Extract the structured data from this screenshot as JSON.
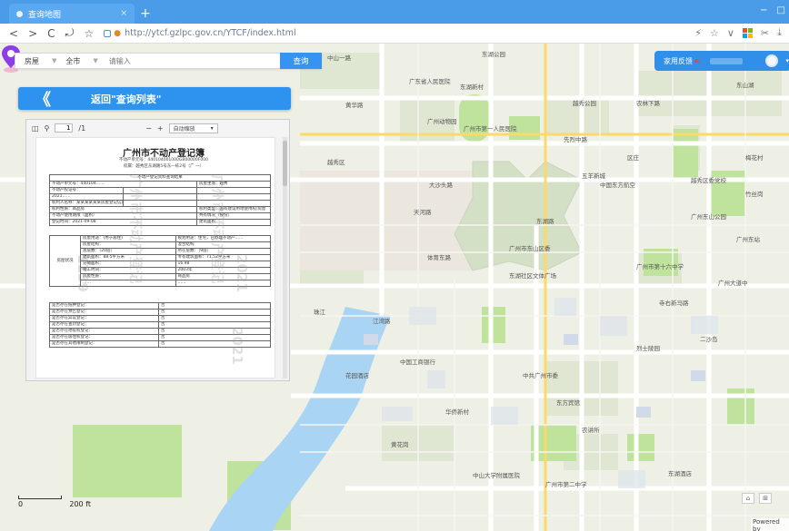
{
  "browser": {
    "tab_title": "查询地图",
    "tab_close": "×",
    "new_tab": "+",
    "win_min": "−",
    "win_max": "□",
    "nav": {
      "back": "<",
      "forward": ">",
      "reload": "C",
      "undo": "⤾",
      "star": "☆"
    },
    "url": "http://ytcf.gzlpc.gov.cn/YTCF/index.html",
    "right_icons": {
      "share": "⚡",
      "fav": "☆",
      "menu": "∨",
      "ms_apps": "ms",
      "cut": "✂",
      "download": "⤓"
    }
  },
  "search": {
    "type_select": "房屋",
    "district_select": "全市",
    "input_placeholder": "请输入",
    "caret": "▼",
    "button": "查询"
  },
  "back_button": {
    "chevron": "《",
    "label": "返回\"查询列表\""
  },
  "user_bar": {
    "label": "家用反馈",
    "dropdown": "▾"
  },
  "doc_viewer": {
    "page": "1",
    "total": "/1",
    "zoom_minus": "−",
    "zoom_plus": "+",
    "zoom_select": "自动缩放",
    "caret": "▾",
    "document": {
      "title": "广州市不动产登记簿",
      "sub1": "不动产单元号：440104001000GB00000F000",
      "sub2": "权属：越秀区东湖路5号东一栋2号（广 一）",
      "head": "不动产登记资料查询结果",
      "rows": [
        [
          "不动产单元号：440104……",
          "房屋坐落：越秀"
        ],
        [
          "不动产权证号：",
          "",
          ""
        ],
        [
          "2021……",
          "",
          ""
        ],
        [
          "权利人名称：某某某某某某房屋登记信息",
          "",
          ""
        ],
        [
          "权利性质：商品房",
          "权利类型：国有建设用地使用权/房屋"
        ],
        [
          "不动产使用期限（面积）",
          "共有情况（按份）"
        ],
        [
          "登记时间：2021-09-08",
          "建筑面积"
        ]
      ],
      "block_label": "房屋状况",
      "block_rows": [
        [
          "房屋用途：(用于居住)",
          "规划用途：住宅，已办理不动产……"
        ],
        [
          "房屋结构：",
          "混合结构"
        ],
        [
          "总层数：（20层）",
          "所在层数：（9层）"
        ],
        [
          "建筑面积：88.5平方米",
          "专有建筑面积：71.52平方米"
        ],
        [
          "分摊面积：",
          "16.98"
        ],
        [
          "竣工时间：",
          "2003年"
        ],
        [
          "房屋性质：",
          "商品房"
        ],
        [
          "……",
          "……"
        ]
      ],
      "q_rows": [
        [
          "是否存在抵押登记：",
          "否"
        ],
        [
          "是否存在预告登记：",
          "否"
        ],
        [
          "是否存在异议登记：",
          "否"
        ],
        [
          "是否存在查封登记：",
          "否"
        ],
        [
          "是否存在地役权登记：",
          "否"
        ],
        [
          "是否存在居住权登记：",
          "否"
        ],
        [
          "是否存在其他限制登记：",
          "否"
        ]
      ],
      "watermarks": [
        "广州市不动产登记",
        "1139",
        "2021",
        "2021"
      ]
    }
  },
  "map": {
    "scale": {
      "zero": "0",
      "dist": "200 ft"
    },
    "powered_by": "Powered by",
    "labels": [
      "黄华路",
      "广东省人民医院",
      "东湖新村",
      "东湖公园",
      "广州动物园",
      "广州市第一人民医院",
      "越秀区",
      "东湖路",
      "大沙头路",
      "五羊新城",
      "东湖社区文体广场",
      "二沙岛",
      "珠江",
      "江湾路",
      "中山一路",
      "先烈中路",
      "农林下路",
      "越秀公园",
      "东山湖",
      "越秀区委党校",
      "广州市第十六中学",
      "广州市东山区委",
      "广州东站",
      "中国东方航空",
      "中共广州市委",
      "中国工商银行",
      "华侨新村",
      "东方宾馆",
      "烈士陵园",
      "农讲所",
      "中山大学附属医院",
      "广州市第二中学",
      "东湖酒店",
      "花园酒店",
      "黄花岗",
      "区庄",
      "梅花村",
      "广州东山公园",
      "竹丝岗",
      "寺右新马路",
      "广州大道中",
      "天河路",
      "体育东路"
    ],
    "bottom_icons": [
      "⌂",
      "⊞"
    ]
  },
  "colors": {
    "brand_blue": "#2e93ee",
    "tabbar": "#4a9be8",
    "pin": "#8e3ee8"
  }
}
